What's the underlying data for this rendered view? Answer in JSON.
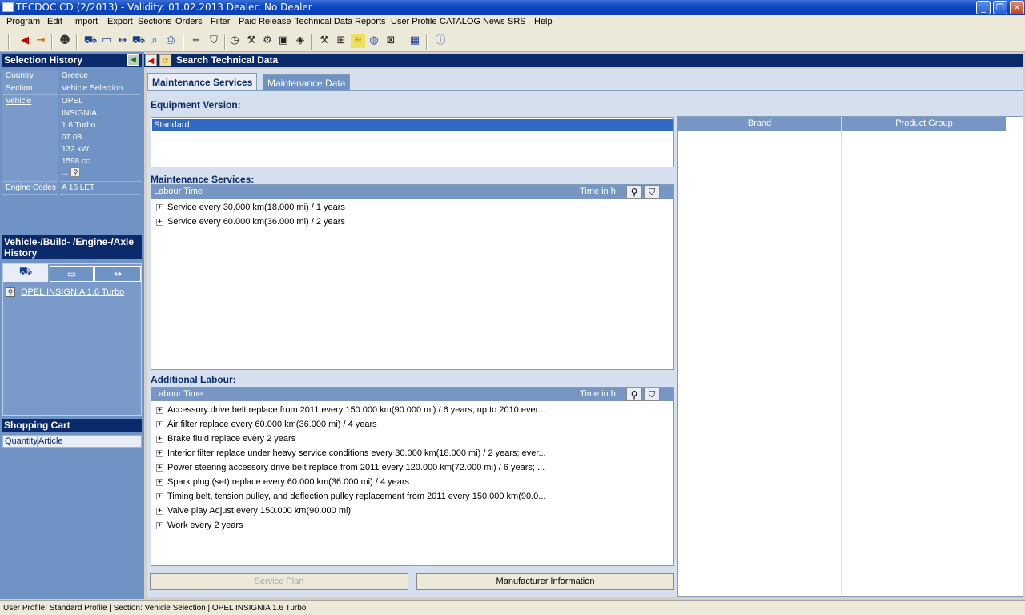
{
  "window": {
    "title": "TECDOC CD (2/2013)  -  Validity: 01.02.2013  Dealer: No Dealer"
  },
  "menu": [
    "Program",
    "Edit",
    "Import",
    "Export",
    "Sections",
    "Orders",
    "Filter",
    "Paid Release",
    "Technical Data",
    "Reports",
    "User Profile",
    "CATALOG News",
    "SRS",
    "Help"
  ],
  "toolbar": {
    "icons": [
      "back-arrow-icon",
      "exit-icon",
      "profile-icon",
      "vehicle-icon",
      "axle-icon",
      "engine-icon",
      "vehicle-search-icon",
      "search-icon",
      "print-icon",
      "list-icon",
      "cart-icon",
      "clock-icon",
      "tools-icon",
      "parts-icon",
      "image-icon",
      "book-icon",
      "wrench-icon",
      "diagram-icon",
      "chart-icon",
      "globe-icon",
      "settings-icon",
      "calendar-icon",
      "help-icon"
    ]
  },
  "sidebar": {
    "selection_history_title": "Selection History",
    "history": [
      {
        "label": "Country",
        "values": [
          "Greece"
        ]
      },
      {
        "label": "Section",
        "values": [
          "Vehicle Selection"
        ]
      },
      {
        "label": "Vehicle",
        "values": [
          "OPEL",
          "INSIGNIA",
          "1.6 Turbo",
          "07.08",
          "132 kW",
          "1598 cc",
          "..."
        ]
      },
      {
        "label": "Engine Codes",
        "values": [
          "A 16 LET"
        ]
      }
    ],
    "vehicle_history_title": "Vehicle-/Build- /Engine-/Axle History",
    "vehicle_history_item": "OPEL INSIGNIA 1.6 Turbo",
    "shopping_cart_title": "Shopping Cart",
    "cart_columns": {
      "quantity": "Quantity",
      "article": "Article"
    }
  },
  "main": {
    "header": "Search Technical Data",
    "tabs": {
      "maintenance_services": "Maintenance Services",
      "maintenance_data": "Maintenance Data"
    },
    "equipment_version_label": "Equipment Version:",
    "equipment_selected": "Standard",
    "maintenance_services_label": "Maintenance Services:",
    "labour_col": "Labour Time",
    "time_col": "Time in h",
    "services": [
      "Service every 30.000 km(18.000 mi) / 1 years",
      "Service every 60.000 km(36.000 mi) / 2 years"
    ],
    "additional_labour_label": "Additional Labour:",
    "additional": [
      "Accessory drive belt replace from 2011 every 150.000 km(90.000 mi)  / 6 years; up to 2010 ever...",
      "Air filter replace every 60.000 km(36.000 mi)  / 4 years",
      "Brake fluid replace every 2 years",
      "Interior filter replace under heavy service conditions every 30.000 km(18.000 mi)  / 2 years; ever...",
      "Power steering accessory drive belt replace from 2011 every 120.000 km(72.000 mi)  / 6 years; ...",
      "Spark plug (set) replace every 60.000 km(36.000 mi)  / 4 years",
      "Timing belt, tension pulley, and deflection pulley replacement  from 2011 every 150.000 km(90.0...",
      "Valve play Adjust every 150.000 km(90.000 mi)",
      "Work every 2 years"
    ],
    "buttons": {
      "service_plan": "Service Plan",
      "manufacturer_info": "Manufacturer Information"
    },
    "right_columns": {
      "brand": "Brand",
      "product_group": "Product Group"
    }
  },
  "statusbar": "User Profile: Standard Profile | Section: Vehicle Selection | OPEL INSIGNIA 1.6 Turbo"
}
